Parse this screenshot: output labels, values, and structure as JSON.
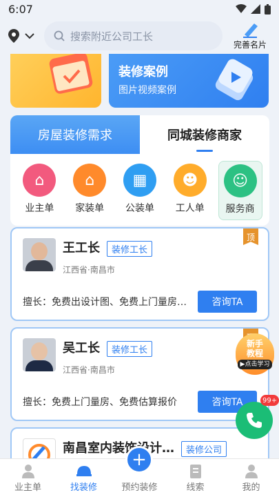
{
  "status": {
    "time": "6:07"
  },
  "header": {
    "search_placeholder": "搜索附近公司工长",
    "namecard_label": "完善名片"
  },
  "banners": {
    "right_title": "装修案例",
    "right_subtitle": "图片视频案例"
  },
  "tabs": [
    {
      "label": "房屋装修需求"
    },
    {
      "label": "同城装修商家"
    }
  ],
  "categories": [
    {
      "label": "业主单",
      "color": "#f25a7e"
    },
    {
      "label": "家装单",
      "color": "#ff8a2b"
    },
    {
      "label": "公装单",
      "color": "#2f9ef2"
    },
    {
      "label": "工人单",
      "color": "#ffac2b"
    },
    {
      "label": "服务商",
      "color": "#2cc183"
    }
  ],
  "listings": [
    {
      "name": "王工长",
      "badge": "装修工长",
      "region": "江西省·南昌市",
      "specialty": "擅长：免费出设计图、免费上门量房…",
      "consult": "咨询TA",
      "pin": "顶"
    },
    {
      "name": "吴工长",
      "badge": "装修工长",
      "region": "江西省·南昌市",
      "specialty": "擅长：免费上门量房、免费估算报价",
      "consult": "咨询TA",
      "pin": "顶"
    },
    {
      "name": "南昌室内装饰设计…",
      "badge": "装修公司"
    }
  ],
  "floating": {
    "tutorial_line1": "新手",
    "tutorial_line2": "教程",
    "tutorial_sub": "▶点击学习",
    "badge": "99+"
  },
  "nav": [
    {
      "label": "业主单"
    },
    {
      "label": "找装修"
    },
    {
      "label": "预约装修"
    },
    {
      "label": "线索"
    },
    {
      "label": "我的"
    }
  ]
}
